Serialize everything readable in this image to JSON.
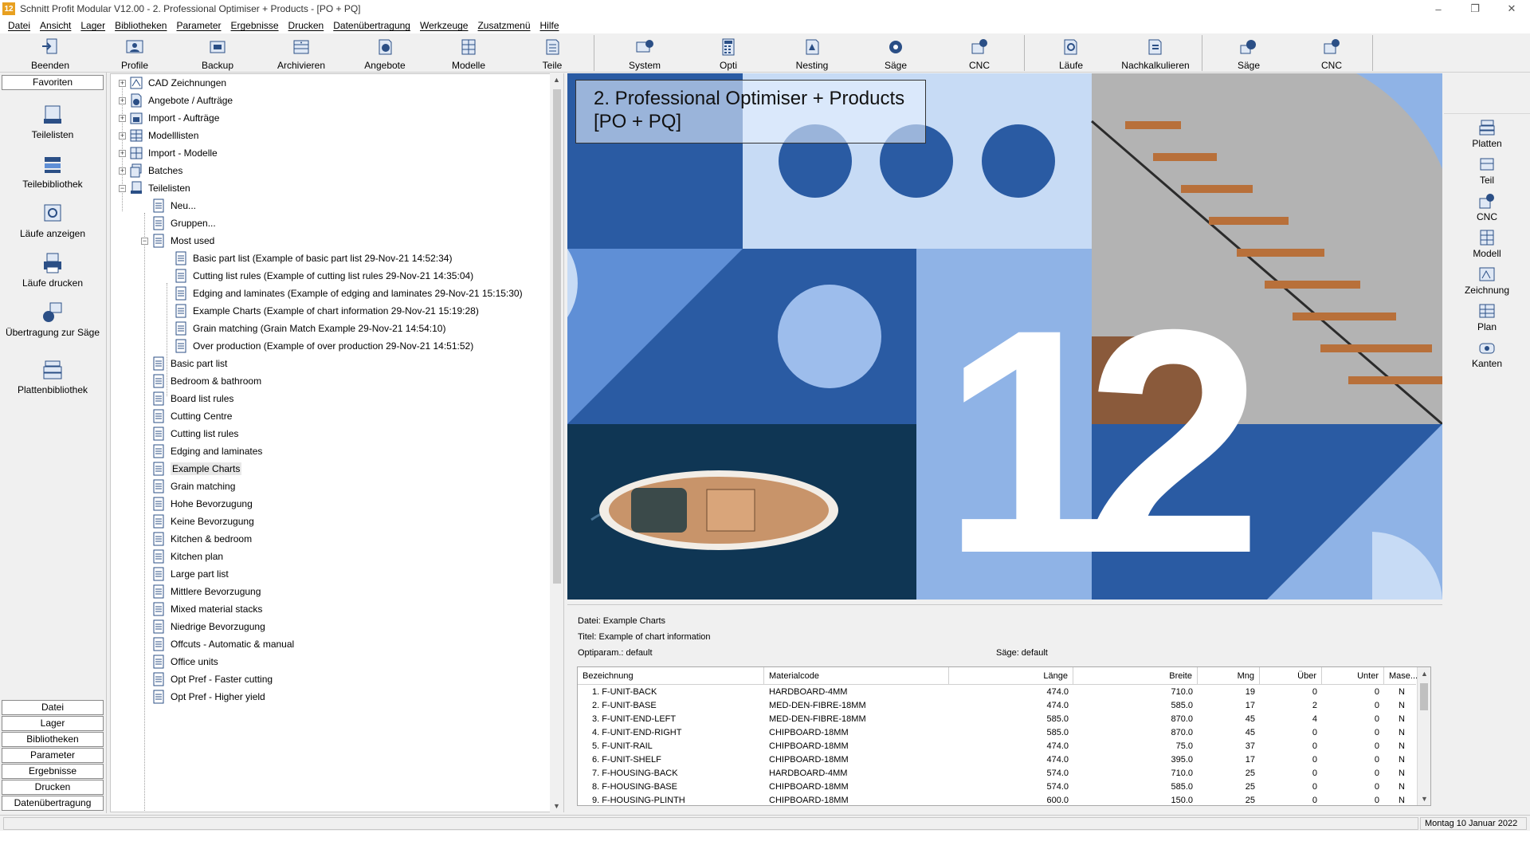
{
  "window": {
    "title": "Schnitt Profit Modular V12.00 - 2. Professional Optimiser + Products - [PO + PQ]",
    "app_icon": "12",
    "minimize": "–",
    "restore": "❐",
    "close": "✕"
  },
  "menu": [
    "Datei",
    "Ansicht",
    "Lager",
    "Bibliotheken",
    "Parameter",
    "Ergebnisse",
    "Drucken",
    "Datenübertragung",
    "Werkzeuge",
    "Zusatzmenü",
    "Hilfe"
  ],
  "toolbar": {
    "beenden": "Beenden",
    "profile": "Profile",
    "backup": "Backup",
    "archivieren": "Archivieren",
    "angebote": "Angebote",
    "modelle": "Modelle",
    "teile": "Teile",
    "system": "System",
    "opti": "Opti",
    "nesting": "Nesting",
    "saege1": "Säge",
    "cnc1": "CNC",
    "laeufe": "Läufe",
    "nachkalkulieren": "Nachkalkulieren",
    "saege2": "Säge",
    "cnc2": "CNC"
  },
  "sidebar": {
    "favoriten": "Favoriten",
    "items": {
      "teilelisten": "Teilelisten",
      "teilebibliothek": "Teilebibliothek",
      "laeufe_anzeigen": "Läufe anzeigen",
      "laeufe_drucken": "Läufe drucken",
      "uebertragung": "Übertragung zur Säge",
      "plattenbibliothek": "Plattenbibliothek"
    },
    "tabs": [
      "Datei",
      "Lager",
      "Bibliotheken",
      "Parameter",
      "Ergebnisse",
      "Drucken",
      "Datenübertragung"
    ]
  },
  "tree": {
    "top": [
      "CAD Zeichnungen",
      "Angebote / Aufträge",
      "Import - Aufträge",
      "Modelllisten",
      "Import - Modelle",
      "Batches",
      "Teilelisten"
    ],
    "teilelisten_children": [
      "Neu...",
      "Gruppen...",
      "Most used"
    ],
    "most_used": [
      "Basic part list (Example of basic part list 29-Nov-21 14:52:34)",
      "Cutting list rules (Example of cutting list rules 29-Nov-21 14:35:04)",
      "Edging and laminates (Example of edging and laminates 29-Nov-21 15:15:30)",
      "Example Charts (Example of chart information 29-Nov-21 15:19:28)",
      "Grain matching (Grain Match Example 29-Nov-21 14:54:10)",
      "Over production (Example of over production 29-Nov-21 14:51:52)"
    ],
    "lists": [
      "Basic part list",
      "Bedroom & bathroom",
      "Board list rules",
      "Cutting Centre",
      "Cutting list rules",
      "Edging and laminates",
      "Example Charts",
      "Grain matching",
      "Hohe Bevorzugung",
      "Keine Bevorzugung",
      "Kitchen & bedroom",
      "Kitchen plan",
      "Large part list",
      "Mittlere Bevorzugung",
      "Mixed material stacks",
      "Niedrige Bevorzugung",
      "Offcuts - Automatic & manual",
      "Office units",
      "Opt Pref - Faster cutting",
      "Opt Pref - Higher yield"
    ],
    "selected": "Example Charts",
    "expanded_sign": "−",
    "collapsed_sign": "+"
  },
  "hero": {
    "caption": "2. Professional Optimiser + Products [PO + PQ]",
    "big_digits": [
      "1",
      "2"
    ],
    "colors": {
      "dark": "#2a5ba3",
      "mid": "#5f8fd6",
      "light": "#9dbdec",
      "pale": "#c7dbf5"
    }
  },
  "rightbar": [
    "Platten",
    "Teil",
    "CNC",
    "Modell",
    "Zeichnung",
    "Plan",
    "Kanten"
  ],
  "info": {
    "datei": "Datei: Example Charts",
    "titel": "Titel: Example of chart information",
    "optiparam": "Optiparam.: default",
    "saege": "Säge: default",
    "columns": [
      "Bezeichnung",
      "Materialcode",
      "Länge",
      "Breite",
      "Mng",
      "Über",
      "Unter",
      "Mase..."
    ],
    "rows": [
      [
        "1. F-UNIT-BACK",
        "HARDBOARD-4MM",
        "474.0",
        "710.0",
        "19",
        "0",
        "0",
        "N"
      ],
      [
        "2. F-UNIT-BASE",
        "MED-DEN-FIBRE-18MM",
        "474.0",
        "585.0",
        "17",
        "2",
        "0",
        "N"
      ],
      [
        "3. F-UNIT-END-LEFT",
        "MED-DEN-FIBRE-18MM",
        "585.0",
        "870.0",
        "45",
        "4",
        "0",
        "N"
      ],
      [
        "4. F-UNIT-END-RIGHT",
        "CHIPBOARD-18MM",
        "585.0",
        "870.0",
        "45",
        "0",
        "0",
        "N"
      ],
      [
        "5. F-UNIT-RAIL",
        "CHIPBOARD-18MM",
        "474.0",
        "75.0",
        "37",
        "0",
        "0",
        "N"
      ],
      [
        "6. F-UNIT-SHELF",
        "CHIPBOARD-18MM",
        "474.0",
        "395.0",
        "17",
        "0",
        "0",
        "N"
      ],
      [
        "7. F-HOUSING-BACK",
        "HARDBOARD-4MM",
        "574.0",
        "710.0",
        "25",
        "0",
        "0",
        "N"
      ],
      [
        "8. F-HOUSING-BASE",
        "CHIPBOARD-18MM",
        "574.0",
        "585.0",
        "25",
        "0",
        "0",
        "N"
      ],
      [
        "9. F-HOUSING-PLINTH",
        "CHIPBOARD-18MM",
        "600.0",
        "150.0",
        "25",
        "0",
        "0",
        "N"
      ]
    ],
    "scroll_up": "▲",
    "scroll_down": "▼"
  },
  "status": {
    "date": "Montag 10 Januar 2022"
  },
  "tree_scroll": {
    "up": "▲",
    "down": "▼"
  }
}
